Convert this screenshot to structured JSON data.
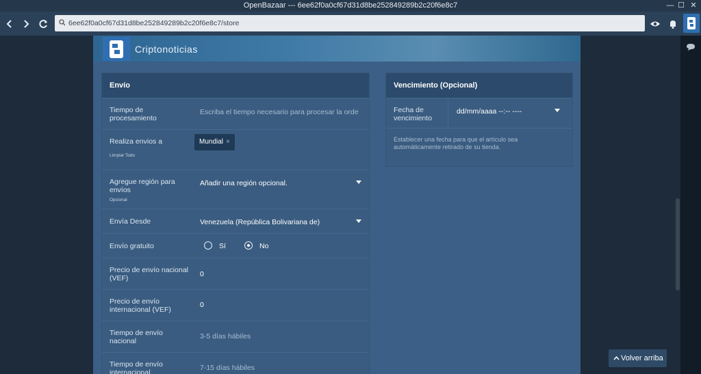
{
  "window": {
    "title": "OpenBazaar --- 6ee62f0a0cf67d31d8be252849289b2c20f6e8c7"
  },
  "navbar": {
    "url": "6ee62f0a0cf67d31d8be252849289b2c20f6e8c7/store"
  },
  "store": {
    "name": "Criptonoticias"
  },
  "shipping": {
    "heading": "Envío",
    "processing_time": {
      "label": "Tiempo de procesamiento",
      "placeholder": "Escriba el tiempo necesario para procesar la orde"
    },
    "ships_to": {
      "label": "Realiza envios a",
      "clear_all": "Limpiar Todo",
      "chip": "Mundial",
      "chip_remove": "×"
    },
    "add_region": {
      "label": "Agregue región para envíos",
      "optional": "Opcional",
      "value": "Añadir una región opcional."
    },
    "ships_from": {
      "label": "Envía Desde",
      "value": "Venezuela (República Bolivariana de)"
    },
    "free_shipping": {
      "label": "Envío gratuito",
      "yes": "Sí",
      "no": "No",
      "selected": "No"
    },
    "domestic_price": {
      "label": "Precio de envío nacional (VEF)",
      "value": "0"
    },
    "intl_price": {
      "label": "Precio de envío internacional (VEF)",
      "value": "0"
    },
    "domestic_time": {
      "label": "Tiempo de envío nacional",
      "placeholder": "3-5 días hábiles"
    },
    "intl_time": {
      "label": "Tiempo de envío internacional",
      "placeholder": "7-15 días hábiles"
    }
  },
  "expiration": {
    "heading": "Vencimiento (Opcional)",
    "date": {
      "label": "Fecha de vencimiento",
      "value": "dd/mm/aaaa --:-- ----"
    },
    "help": "Establecer una fecha para que el artículo sea automáticamente retirado de su tienda."
  },
  "back_to_top": {
    "label": "Volver arriba"
  }
}
